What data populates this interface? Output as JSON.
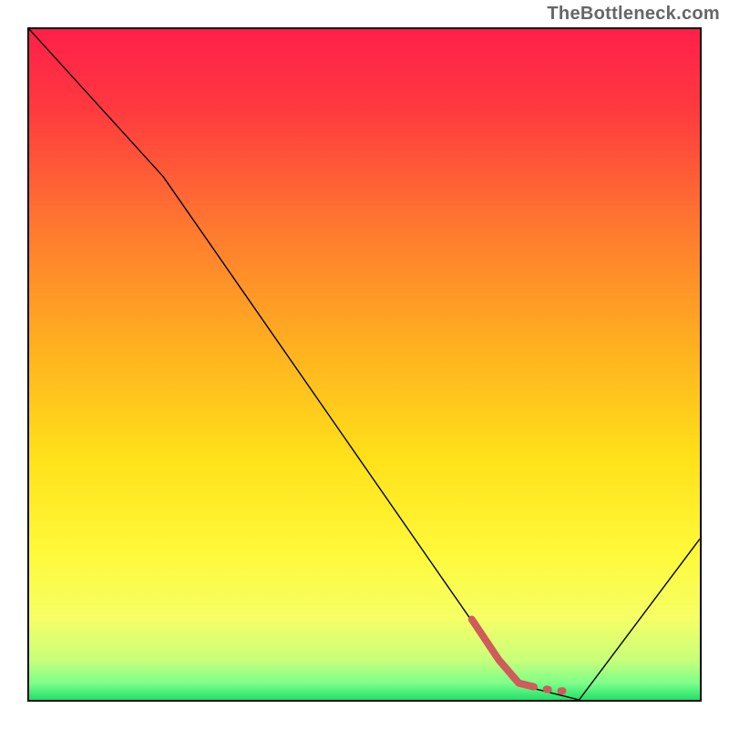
{
  "attribution": "TheBottleneck.com",
  "chart_data": {
    "type": "line",
    "title": "",
    "xlabel": "",
    "ylabel": "",
    "xlim": [
      0,
      100
    ],
    "ylim": [
      0,
      100
    ],
    "series": [
      {
        "name": "curve",
        "x": [
          0,
          20,
          70,
          74,
          82,
          100
        ],
        "y": [
          100,
          78,
          6,
          2,
          0,
          24
        ],
        "stroke": "#000000",
        "width": 1.4
      },
      {
        "name": "highlight-dashed",
        "x": [
          66,
          70,
          73,
          75,
          77,
          79,
          81
        ],
        "y": [
          12,
          6,
          2.5,
          2,
          1.6,
          1.3,
          1.4
        ],
        "stroke": "#cf5b5b",
        "width": 8,
        "dashed_tail_from_index": 3
      }
    ],
    "background_gradient": [
      {
        "stop": 0.0,
        "color": "#ff1f4a"
      },
      {
        "stop": 0.12,
        "color": "#ff3a3f"
      },
      {
        "stop": 0.3,
        "color": "#ff7a2f"
      },
      {
        "stop": 0.48,
        "color": "#ffb21f"
      },
      {
        "stop": 0.64,
        "color": "#ffe11a"
      },
      {
        "stop": 0.78,
        "color": "#fff93a"
      },
      {
        "stop": 0.88,
        "color": "#f5ff66"
      },
      {
        "stop": 0.94,
        "color": "#c9ff7a"
      },
      {
        "stop": 0.975,
        "color": "#7dff8a"
      },
      {
        "stop": 1.0,
        "color": "#22e06a"
      }
    ]
  }
}
